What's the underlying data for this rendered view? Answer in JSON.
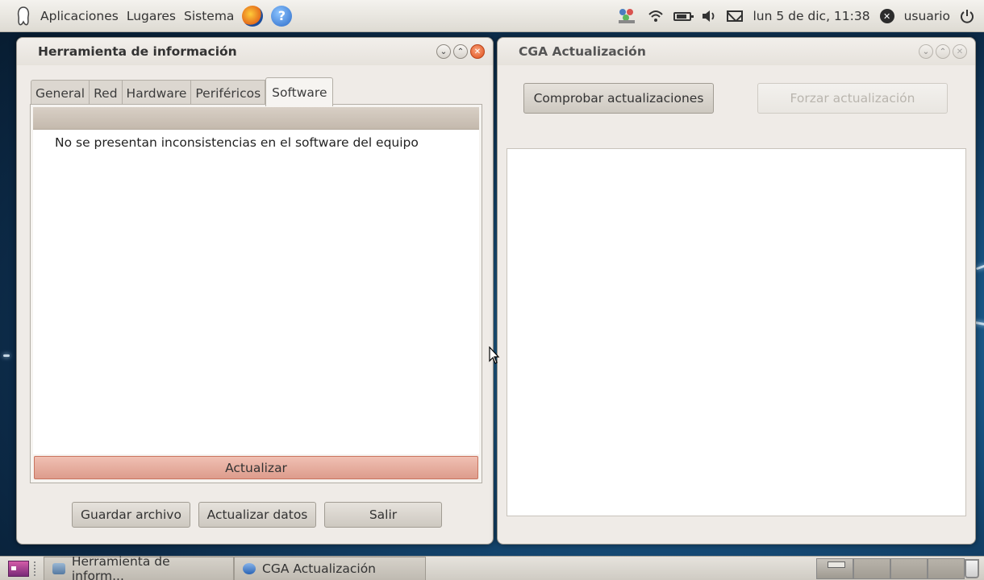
{
  "top_panel": {
    "menus": [
      "Aplicaciones",
      "Lugares",
      "Sistema"
    ],
    "datetime": "lun  5 de dic, 11:38",
    "user": "usuario"
  },
  "window1": {
    "title": "Herramienta de información",
    "tabs": [
      "General",
      "Red",
      "Hardware",
      "Periféricos",
      "Software"
    ],
    "active_tab": "Software",
    "message": "No se presentan inconsistencias en el software del equipo",
    "refresh_button": "Actualizar",
    "buttons": {
      "save": "Guardar archivo",
      "update_data": "Actualizar datos",
      "exit": "Salir"
    }
  },
  "window2": {
    "title": "CGA Actualización",
    "check_button": "Comprobar actualizaciones",
    "force_button": "Forzar actualización"
  },
  "taskbar": {
    "tasks": [
      "Herramienta de inform...",
      "CGA Actualización"
    ]
  },
  "colors": {
    "accent_button": "#dd9c8c",
    "window_bg": "#efebe7",
    "panel_bg": "#dedbd3"
  }
}
